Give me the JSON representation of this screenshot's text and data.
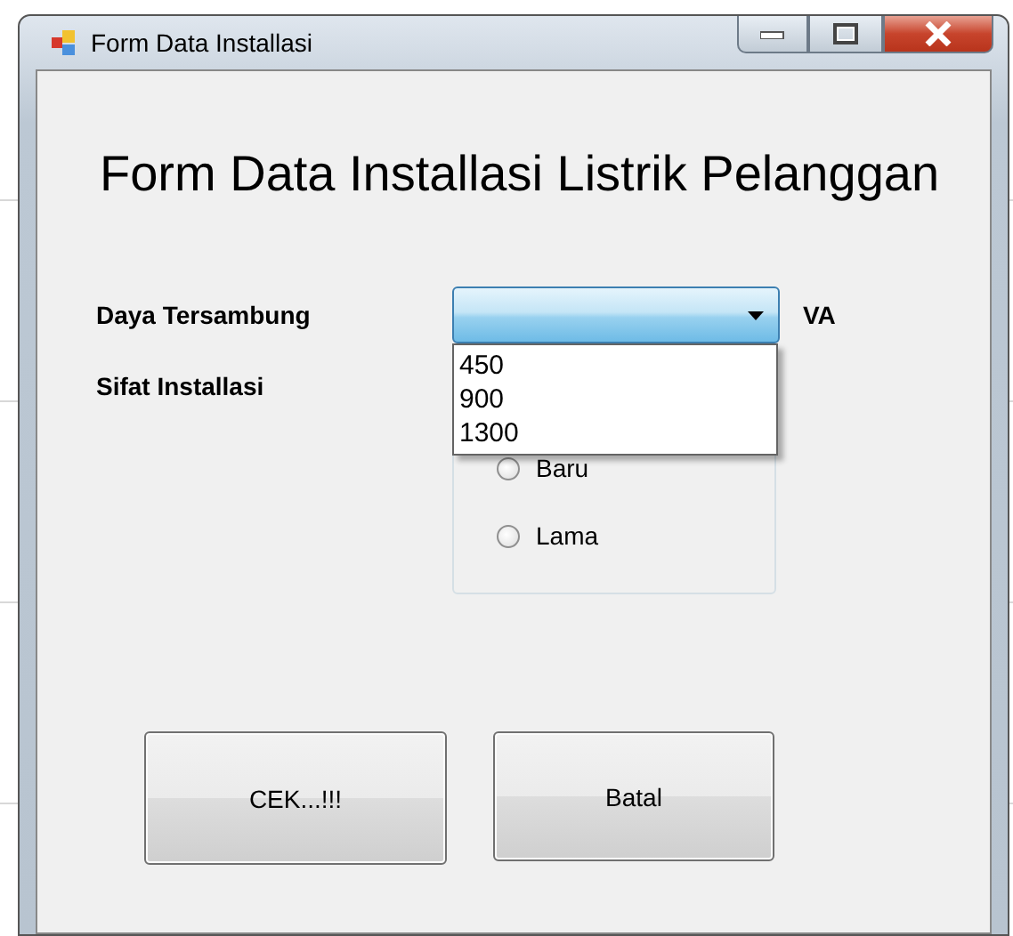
{
  "window": {
    "title": "Form Data Installasi"
  },
  "heading": "Form Data Installasi Listrik Pelanggan",
  "daya": {
    "label": "Daya Tersambung",
    "expanded": true,
    "unit": "VA",
    "options": [
      "450",
      "900",
      "1300"
    ]
  },
  "sifat": {
    "label": "Sifat Installasi",
    "options": [
      {
        "label": "Baru",
        "selected": false
      },
      {
        "label": "Lama",
        "selected": false
      }
    ]
  },
  "buttons": [
    "CEK...!!!",
    "Batal"
  ]
}
